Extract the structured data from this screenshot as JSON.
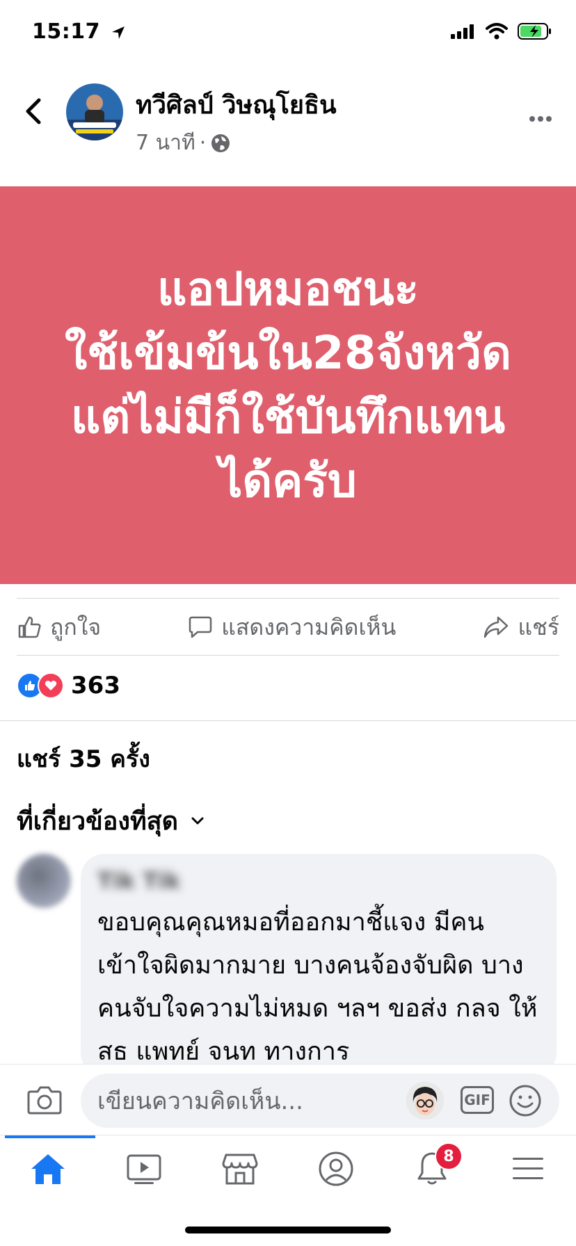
{
  "status_bar": {
    "time": "15:17"
  },
  "post": {
    "author": "ทวีศิลป์ วิษณุโยธิน",
    "time_ago": "7 นาที",
    "separator": "·",
    "body_lines": [
      "แอปหมอชนะ",
      "ใช้เข้มข้นใน28จังหวัด",
      "แต่ไม่มีก็ใช้บันทึกแทน",
      "ได้ครับ"
    ],
    "background_color": "#df5f6d"
  },
  "actions": {
    "like": "ถูกใจ",
    "comment": "แสดงความคิดเห็น",
    "share": "แชร์"
  },
  "reactions": {
    "count": "363"
  },
  "shares": "แชร์ 35 ครั้ง",
  "comments_sort": "ที่เกี่ยวข้องที่สุด",
  "comment": {
    "author": "Tik Tik",
    "text": "ขอบคุณคุณหมอที่ออกมาชี้แจง มีคนเข้าใจผิดมากมาย บางคนจ้องจับผิด บางคนจับใจความไม่หมด ฯลฯ ขอส่ง กลจ ให้ สธ แพทย์ จนท ทางการ"
  },
  "composer": {
    "placeholder": "เขียนความคิดเห็น...",
    "gif_label": "GIF"
  },
  "tabbar": {
    "tabs": [
      "home",
      "watch",
      "marketplace",
      "profile",
      "notifications",
      "menu"
    ],
    "notification_badge": "8",
    "active_color": "#1877f2"
  }
}
